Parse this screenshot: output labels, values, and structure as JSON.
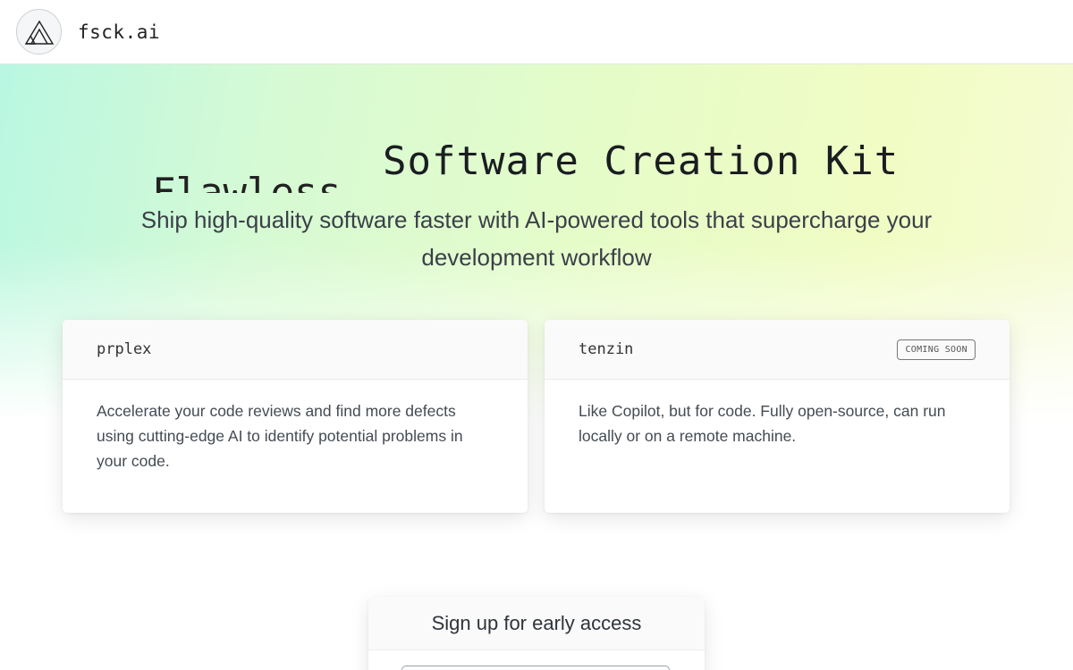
{
  "header": {
    "logo_icon": "triangle-logo-icon",
    "brand": "fsck.ai"
  },
  "hero": {
    "title_ghost": "Flawless",
    "title": "Software Creation Kit",
    "subtitle": "Ship high-quality software faster with AI-powered tools that supercharge your development workflow"
  },
  "products": [
    {
      "name": "prplex",
      "badge": "",
      "description": "Accelerate your code reviews and find more defects using cutting-edge AI to identify potential problems in your code."
    },
    {
      "name": "tenzin",
      "badge": "COMING SOON",
      "description": "Like Copilot, but for code. Fully open-source, can run locally or on a remote machine."
    }
  ],
  "signup": {
    "title": "Sign up for early access",
    "email_value": "",
    "email_placeholder": ""
  }
}
